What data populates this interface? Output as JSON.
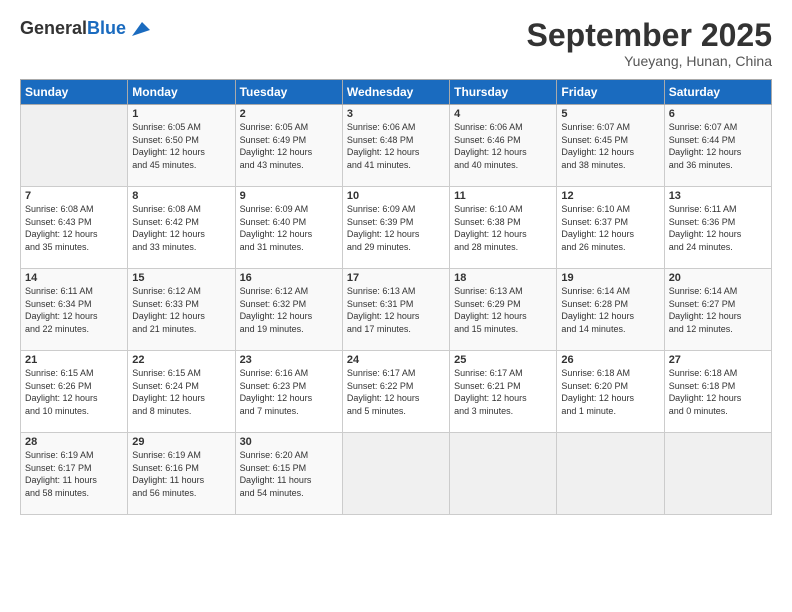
{
  "logo": {
    "general": "General",
    "blue": "Blue"
  },
  "header": {
    "title": "September 2025",
    "subtitle": "Yueyang, Hunan, China"
  },
  "days_of_week": [
    "Sunday",
    "Monday",
    "Tuesday",
    "Wednesday",
    "Thursday",
    "Friday",
    "Saturday"
  ],
  "weeks": [
    [
      {
        "day": "",
        "info": ""
      },
      {
        "day": "1",
        "info": "Sunrise: 6:05 AM\nSunset: 6:50 PM\nDaylight: 12 hours\nand 45 minutes."
      },
      {
        "day": "2",
        "info": "Sunrise: 6:05 AM\nSunset: 6:49 PM\nDaylight: 12 hours\nand 43 minutes."
      },
      {
        "day": "3",
        "info": "Sunrise: 6:06 AM\nSunset: 6:48 PM\nDaylight: 12 hours\nand 41 minutes."
      },
      {
        "day": "4",
        "info": "Sunrise: 6:06 AM\nSunset: 6:46 PM\nDaylight: 12 hours\nand 40 minutes."
      },
      {
        "day": "5",
        "info": "Sunrise: 6:07 AM\nSunset: 6:45 PM\nDaylight: 12 hours\nand 38 minutes."
      },
      {
        "day": "6",
        "info": "Sunrise: 6:07 AM\nSunset: 6:44 PM\nDaylight: 12 hours\nand 36 minutes."
      }
    ],
    [
      {
        "day": "7",
        "info": "Sunrise: 6:08 AM\nSunset: 6:43 PM\nDaylight: 12 hours\nand 35 minutes."
      },
      {
        "day": "8",
        "info": "Sunrise: 6:08 AM\nSunset: 6:42 PM\nDaylight: 12 hours\nand 33 minutes."
      },
      {
        "day": "9",
        "info": "Sunrise: 6:09 AM\nSunset: 6:40 PM\nDaylight: 12 hours\nand 31 minutes."
      },
      {
        "day": "10",
        "info": "Sunrise: 6:09 AM\nSunset: 6:39 PM\nDaylight: 12 hours\nand 29 minutes."
      },
      {
        "day": "11",
        "info": "Sunrise: 6:10 AM\nSunset: 6:38 PM\nDaylight: 12 hours\nand 28 minutes."
      },
      {
        "day": "12",
        "info": "Sunrise: 6:10 AM\nSunset: 6:37 PM\nDaylight: 12 hours\nand 26 minutes."
      },
      {
        "day": "13",
        "info": "Sunrise: 6:11 AM\nSunset: 6:36 PM\nDaylight: 12 hours\nand 24 minutes."
      }
    ],
    [
      {
        "day": "14",
        "info": "Sunrise: 6:11 AM\nSunset: 6:34 PM\nDaylight: 12 hours\nand 22 minutes."
      },
      {
        "day": "15",
        "info": "Sunrise: 6:12 AM\nSunset: 6:33 PM\nDaylight: 12 hours\nand 21 minutes."
      },
      {
        "day": "16",
        "info": "Sunrise: 6:12 AM\nSunset: 6:32 PM\nDaylight: 12 hours\nand 19 minutes."
      },
      {
        "day": "17",
        "info": "Sunrise: 6:13 AM\nSunset: 6:31 PM\nDaylight: 12 hours\nand 17 minutes."
      },
      {
        "day": "18",
        "info": "Sunrise: 6:13 AM\nSunset: 6:29 PM\nDaylight: 12 hours\nand 15 minutes."
      },
      {
        "day": "19",
        "info": "Sunrise: 6:14 AM\nSunset: 6:28 PM\nDaylight: 12 hours\nand 14 minutes."
      },
      {
        "day": "20",
        "info": "Sunrise: 6:14 AM\nSunset: 6:27 PM\nDaylight: 12 hours\nand 12 minutes."
      }
    ],
    [
      {
        "day": "21",
        "info": "Sunrise: 6:15 AM\nSunset: 6:26 PM\nDaylight: 12 hours\nand 10 minutes."
      },
      {
        "day": "22",
        "info": "Sunrise: 6:15 AM\nSunset: 6:24 PM\nDaylight: 12 hours\nand 8 minutes."
      },
      {
        "day": "23",
        "info": "Sunrise: 6:16 AM\nSunset: 6:23 PM\nDaylight: 12 hours\nand 7 minutes."
      },
      {
        "day": "24",
        "info": "Sunrise: 6:17 AM\nSunset: 6:22 PM\nDaylight: 12 hours\nand 5 minutes."
      },
      {
        "day": "25",
        "info": "Sunrise: 6:17 AM\nSunset: 6:21 PM\nDaylight: 12 hours\nand 3 minutes."
      },
      {
        "day": "26",
        "info": "Sunrise: 6:18 AM\nSunset: 6:20 PM\nDaylight: 12 hours\nand 1 minute."
      },
      {
        "day": "27",
        "info": "Sunrise: 6:18 AM\nSunset: 6:18 PM\nDaylight: 12 hours\nand 0 minutes."
      }
    ],
    [
      {
        "day": "28",
        "info": "Sunrise: 6:19 AM\nSunset: 6:17 PM\nDaylight: 11 hours\nand 58 minutes."
      },
      {
        "day": "29",
        "info": "Sunrise: 6:19 AM\nSunset: 6:16 PM\nDaylight: 11 hours\nand 56 minutes."
      },
      {
        "day": "30",
        "info": "Sunrise: 6:20 AM\nSunset: 6:15 PM\nDaylight: 11 hours\nand 54 minutes."
      },
      {
        "day": "",
        "info": ""
      },
      {
        "day": "",
        "info": ""
      },
      {
        "day": "",
        "info": ""
      },
      {
        "day": "",
        "info": ""
      }
    ]
  ]
}
